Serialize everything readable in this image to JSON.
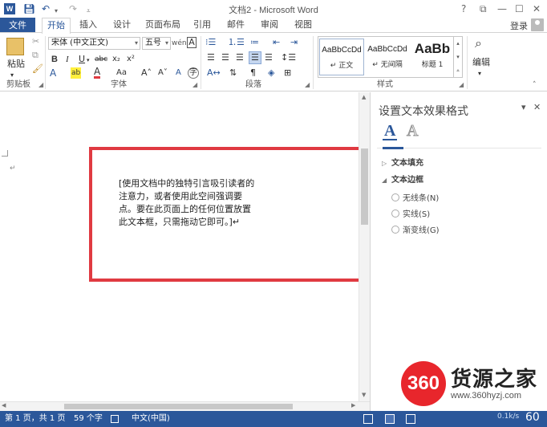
{
  "app": {
    "title": "文档2 - Microsoft Word",
    "qat_icons": [
      "save-icon",
      "undo-icon",
      "redo-icon",
      "customize-icon"
    ],
    "window_controls": {
      "help": "?",
      "restore_ribbon": "⧉",
      "minimize": "—",
      "maximize": "☐",
      "close": "✕"
    },
    "login": "登录"
  },
  "tabs": [
    {
      "label": "文件",
      "active": false
    },
    {
      "label": "开始",
      "active": true
    },
    {
      "label": "插入",
      "active": false
    },
    {
      "label": "设计",
      "active": false
    },
    {
      "label": "页面布局",
      "active": false
    },
    {
      "label": "引用",
      "active": false
    },
    {
      "label": "邮件",
      "active": false
    },
    {
      "label": "审阅",
      "active": false
    },
    {
      "label": "视图",
      "active": false
    }
  ],
  "ribbon": {
    "clipboard": {
      "paste": "粘贴",
      "label": "剪贴板"
    },
    "font": {
      "name": "宋体 (中文正文)",
      "size": "五号",
      "grow": "A˄",
      "shrink": "A˅",
      "clear": "Aa",
      "phonetic": "wén",
      "border": "A",
      "bold": "B",
      "italic": "I",
      "underline": "U",
      "strike": "abc",
      "subscript": "x₂",
      "superscript": "x²",
      "effects": "A",
      "highlight": "ab",
      "color": "A",
      "case": "Aa",
      "enclose": "A",
      "circle": "字",
      "label": "字体"
    },
    "paragraph": {
      "label": "段落"
    },
    "styles": {
      "items": [
        {
          "sample": "AaBbCcDd",
          "name": "↵ 正文",
          "selected": true
        },
        {
          "sample": "AaBbCcDd",
          "name": "↵ 无间隔",
          "selected": false
        },
        {
          "sample": "AaBb",
          "name": "标题 1",
          "selected": false
        }
      ],
      "label": "样式"
    },
    "editing": {
      "label": "编辑"
    }
  },
  "document": {
    "paragraph_mark": "↵",
    "textbox_text": "[使用文档中的独特引言吸引读者的注意力，或者使用此空间强调要点。要在此页面上的任何位置放置此文本框，只需拖动它即可。]↵"
  },
  "pane": {
    "title": "设置文本效果格式",
    "pin": "▾",
    "close": "✕",
    "icon_a": "A",
    "icon_b": "A",
    "sections": [
      {
        "label": "文本填充",
        "expanded": false
      },
      {
        "label": "文本边框",
        "expanded": true
      }
    ],
    "options": [
      "无线条(N)",
      "实线(S)",
      "渐变线(G)"
    ]
  },
  "status": {
    "page": "第 1 页，共 1 页",
    "words": "59 个字",
    "language": "中文(中国)"
  },
  "watermark": {
    "logo": "360",
    "name": "货源之家",
    "url": "www.360hyzj.com",
    "net": "0.1k/s",
    "zoom": "60"
  }
}
